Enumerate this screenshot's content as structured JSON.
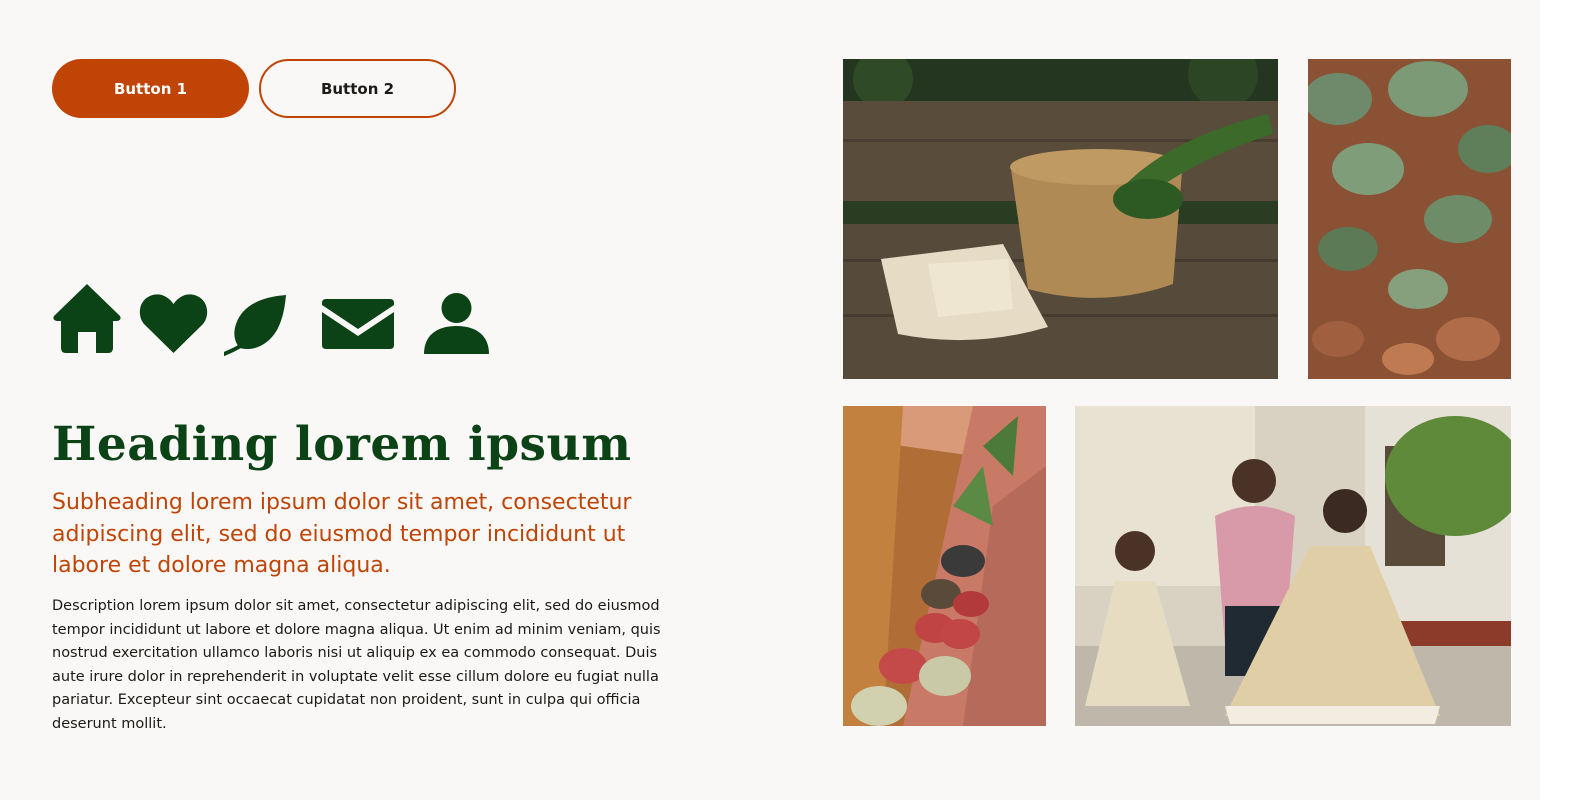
{
  "buttons": {
    "primary_label": "Button 1",
    "secondary_label": "Button 2"
  },
  "icons": [
    "home-icon",
    "heart-icon",
    "leaf-icon",
    "mail-icon",
    "user-icon"
  ],
  "content": {
    "heading": "Heading lorem ipsum",
    "subheading": "Subheading lorem ipsum dolor sit amet, consectetur adipiscing elit, sed do eiusmod tempor incididunt ut labore et dolore magna aliqua.",
    "description": "Description lorem ipsum dolor sit amet, consectetur adipiscing elit, sed do eiusmod tempor incididunt ut labore et dolore magna aliqua. Ut enim ad minim veniam, quis nostrud exercitation ullamco laboris nisi ut aliquip ex ea commodo consequat. Duis aute irure dolor in reprehenderit in voluptate velit esse cillum dolore eu fugiat nulla pariatur. Excepteur sint occaecat cupidatat non proident, sunt in culpa qui officia deserunt mollit."
  },
  "gallery": [
    "basket-photo",
    "ivy-leaves-photo",
    "potted-plants-photo",
    "family-dancing-photo"
  ],
  "colors": {
    "background": "#faf8f6",
    "primary": "#bf4406",
    "heading": "#0c4316",
    "icon": "#0c4316",
    "text": "#1c1a17"
  }
}
